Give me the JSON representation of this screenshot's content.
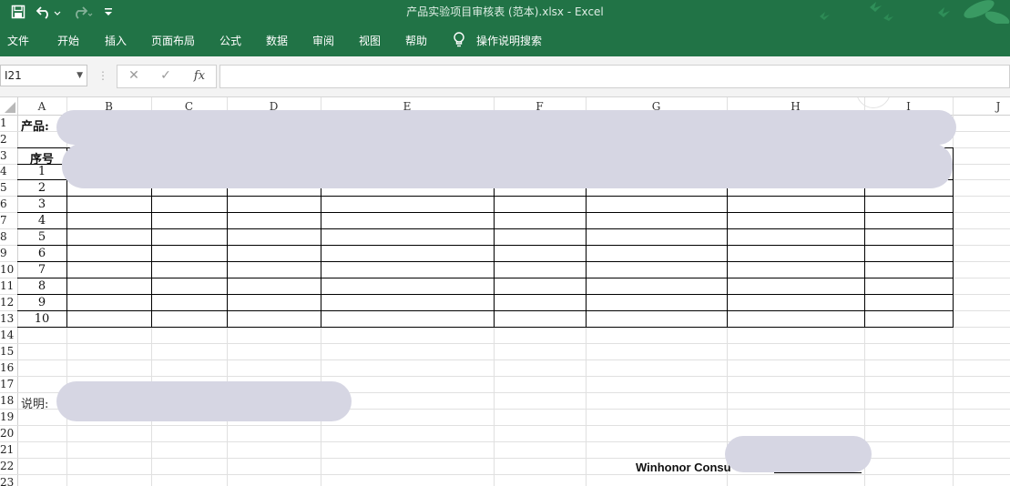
{
  "window": {
    "title": "产品实验项目审核表 (范本).xlsx  -  Excel"
  },
  "quick_access": {
    "save_icon": "save-icon",
    "undo_icon": "undo-icon",
    "redo_icon": "redo-icon",
    "customize_icon": "customize-qat-icon"
  },
  "ribbon": {
    "tabs": [
      "文件",
      "开始",
      "插入",
      "页面布局",
      "公式",
      "数据",
      "审阅",
      "视图",
      "帮助"
    ],
    "tell_me_label": "操作说明搜索"
  },
  "formula_bar": {
    "name_box": "I21",
    "cancel_icon": "cancel-icon",
    "enter_icon": "enter-icon",
    "function_icon": "insert-function-icon",
    "fx_label": "fx",
    "value": ""
  },
  "sheet": {
    "columns": [
      "A",
      "B",
      "C",
      "D",
      "E",
      "F",
      "G",
      "H",
      "I",
      "J"
    ],
    "rows": [
      "1",
      "2",
      "3",
      "4",
      "5",
      "6",
      "7",
      "8",
      "9",
      "10",
      "11",
      "12",
      "13",
      "14",
      "15",
      "16",
      "17",
      "18",
      "19",
      "20",
      "21",
      "22",
      "23"
    ],
    "product_label": "产品:",
    "header_seq": "序号",
    "seq_numbers": [
      "1",
      "2",
      "3",
      "4",
      "5",
      "6",
      "7",
      "8",
      "9",
      "10"
    ],
    "note_label": "说明:",
    "footer_text": "Winhonor Consu",
    "redaction_color": "#d6d6e3"
  },
  "colors": {
    "accent": "#217346",
    "grid": "#e0e0e0"
  }
}
